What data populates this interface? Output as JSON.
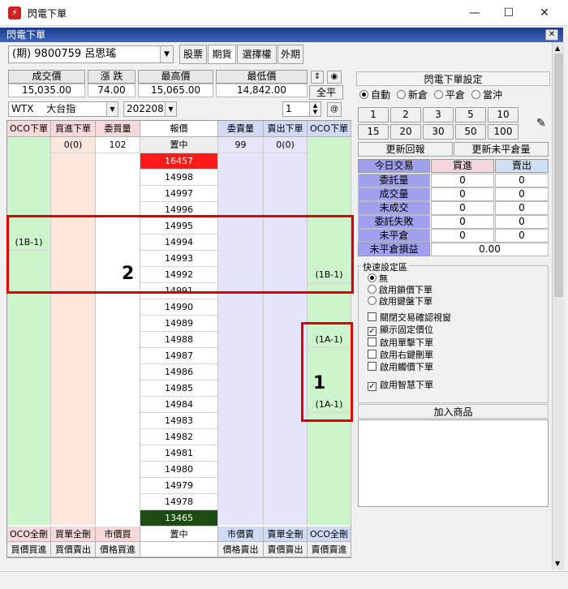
{
  "window": {
    "title": "閃電下單",
    "inner_title": "閃電下單",
    "minimize": "—",
    "maximize": "☐",
    "close": "✕",
    "inner_close": "✕"
  },
  "account": {
    "value": "(期) 9800759 呂思瑤"
  },
  "market_tabs": [
    "股票",
    "期貨",
    "選擇權",
    "外期"
  ],
  "quote": {
    "labels": [
      "成交價",
      "漲 跌",
      "最高價",
      "最低價"
    ],
    "values": [
      "15,035.00",
      "74.00",
      "15,065.00",
      "14,842.00"
    ]
  },
  "full_flat": "全平",
  "product": {
    "symbol": "WTX",
    "name": "大台指",
    "month": "202208",
    "qty": "1"
  },
  "ladder": {
    "headers": [
      "OCO下單",
      "買進下單",
      "委買量",
      "報價",
      "委賣量",
      "賣出下單",
      "OCO下單"
    ],
    "top_row": {
      "buy_order": "0(0)",
      "bid_qty": "102",
      "price": "置中",
      "ask_qty": "99",
      "sell_order": "0(0)"
    },
    "limit_up": "16457",
    "prices": [
      "14998",
      "14997",
      "14996",
      "14995",
      "14994",
      "14993",
      "14992",
      "14991",
      "14990",
      "14989",
      "14988",
      "14987",
      "14986",
      "14985",
      "14984",
      "14983",
      "14982",
      "14981",
      "14980",
      "14979",
      "14978"
    ],
    "limit_down": "13465",
    "oco_left": {
      "14994": "(1B-1)"
    },
    "oco_right": {
      "14992": "(1B-1)",
      "14988": "(1A-1)",
      "14984": "(1A-1)"
    },
    "footer1": [
      "OCO全刪",
      "買單全刪",
      "市價買",
      "置中",
      "市價賣",
      "賣單全刪",
      "OCO全刪"
    ],
    "footer2": [
      "買價買進",
      "買價賣出",
      "價格買進",
      "",
      "價格賣出",
      "賣價賣出",
      "賣價賣進"
    ]
  },
  "annotations": {
    "box1": "1",
    "box2": "2"
  },
  "settings": {
    "title": "閃電下單設定",
    "modes": [
      "自動",
      "新倉",
      "平倉",
      "當沖"
    ],
    "qty_buttons": [
      "1",
      "2",
      "3",
      "5",
      "10",
      "15",
      "20",
      "30",
      "50",
      "100"
    ],
    "refresh_report": "更新回報",
    "refresh_unfilled": "更新未平倉量",
    "table": {
      "header": [
        "今日交易",
        "買進",
        "賣出"
      ],
      "rows": [
        [
          "委託量",
          "0",
          "0"
        ],
        [
          "成交量",
          "0",
          "0"
        ],
        [
          "未成交",
          "0",
          "0"
        ],
        [
          "委託失敗",
          "0",
          "0"
        ],
        [
          "未平倉",
          "0",
          "0"
        ]
      ],
      "pnl_label": "未平倉損益",
      "pnl_value": "0.00"
    },
    "quick_title": "快速設定區",
    "quick_radios": [
      "無",
      "啟用鎖價下單",
      "啟用鍵盤下單"
    ],
    "checks": [
      "關閉交易確認視窗",
      "顯示固定價位",
      "啟用單擊下單",
      "啟用右鍵刪單",
      "啟用觸價下單",
      "啟用智慧下單"
    ],
    "checks_state": [
      false,
      true,
      false,
      false,
      false,
      true
    ],
    "add_product": "加入商品"
  },
  "colors": {
    "limit_up": "#ff1a1a",
    "limit_down": "#1b4d13",
    "oco": "#ccf5cc",
    "buy": "#fde7dc",
    "sell": "#e4e4fa",
    "price": "#ffffff"
  }
}
